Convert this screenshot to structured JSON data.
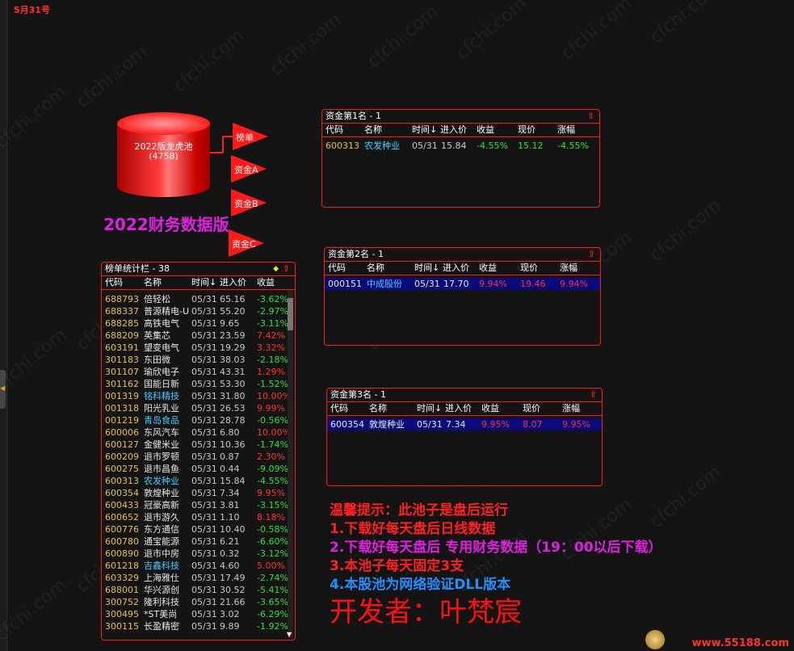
{
  "date_label": "5月31号",
  "watermark": "cfchi.com",
  "pool": {
    "title": "2022版龙虎池",
    "count": "(4758)",
    "flags": [
      "榜单",
      "资金A",
      "资金B",
      "资金C"
    ]
  },
  "big_title": "2022财务数据版",
  "ranking_panel": {
    "title": "榜单统计栏 - 38",
    "headers": [
      "代码",
      "名称",
      "时间↓",
      "进入价",
      "收益"
    ],
    "rows": [
      {
        "code": "688793",
        "name": "倍轻松",
        "time": "05/31",
        "price": "65.16",
        "ret": "-3.62%",
        "name_color": "white",
        "ret_color": "green"
      },
      {
        "code": "688337",
        "name": "普源精电-U",
        "time": "05/31",
        "price": "55.20",
        "ret": "-2.97%",
        "name_color": "white",
        "ret_color": "green"
      },
      {
        "code": "688285",
        "name": "高铁电气",
        "time": "05/31",
        "price": "9.65",
        "ret": "-3.11%",
        "name_color": "white",
        "ret_color": "green"
      },
      {
        "code": "688209",
        "name": "英集芯",
        "time": "05/31",
        "price": "23.59",
        "ret": "7.42%",
        "name_color": "white",
        "ret_color": "red"
      },
      {
        "code": "603191",
        "name": "望变电气",
        "time": "05/31",
        "price": "19.29",
        "ret": "3.32%",
        "name_color": "white",
        "ret_color": "red"
      },
      {
        "code": "301183",
        "name": "东田微",
        "time": "05/31",
        "price": "38.03",
        "ret": "-2.18%",
        "name_color": "white",
        "ret_color": "green"
      },
      {
        "code": "301107",
        "name": "瑜欣电子",
        "time": "05/31",
        "price": "43.31",
        "ret": "1.29%",
        "name_color": "white",
        "ret_color": "red"
      },
      {
        "code": "301162",
        "name": "国能日新",
        "time": "05/31",
        "price": "53.30",
        "ret": "-1.52%",
        "name_color": "white",
        "ret_color": "green"
      },
      {
        "code": "001319",
        "name": "铭科精技",
        "time": "05/31",
        "price": "31.80",
        "ret": "10.00%",
        "name_color": "cyan",
        "ret_color": "red"
      },
      {
        "code": "001318",
        "name": "阳光乳业",
        "time": "05/31",
        "price": "26.53",
        "ret": "9.99%",
        "name_color": "white",
        "ret_color": "red"
      },
      {
        "code": "001219",
        "name": "青岛食品",
        "time": "05/31",
        "price": "28.78",
        "ret": "-0.56%",
        "name_color": "cyan",
        "ret_color": "green"
      },
      {
        "code": "600006",
        "name": "东风汽车",
        "time": "05/31",
        "price": "6.80",
        "ret": "10.00%",
        "name_color": "white",
        "ret_color": "red"
      },
      {
        "code": "600127",
        "name": "金健米业",
        "time": "05/31",
        "price": "10.36",
        "ret": "-1.74%",
        "name_color": "white",
        "ret_color": "green"
      },
      {
        "code": "600209",
        "name": "退市罗顿",
        "time": "05/31",
        "price": "0.87",
        "ret": "2.30%",
        "name_color": "white",
        "ret_color": "red"
      },
      {
        "code": "600275",
        "name": "退市昌鱼",
        "time": "05/31",
        "price": "0.44",
        "ret": "-9.09%",
        "name_color": "white",
        "ret_color": "green"
      },
      {
        "code": "600313",
        "name": "农发种业",
        "time": "05/31",
        "price": "15.84",
        "ret": "-4.55%",
        "name_color": "cyan",
        "ret_color": "green"
      },
      {
        "code": "600354",
        "name": "敦煌种业",
        "time": "05/31",
        "price": "7.34",
        "ret": "9.95%",
        "name_color": "white",
        "ret_color": "red"
      },
      {
        "code": "600433",
        "name": "冠豪高新",
        "time": "05/31",
        "price": "3.81",
        "ret": "-3.15%",
        "name_color": "white",
        "ret_color": "green"
      },
      {
        "code": "600652",
        "name": "退市游久",
        "time": "05/31",
        "price": "1.10",
        "ret": "8.18%",
        "name_color": "white",
        "ret_color": "red"
      },
      {
        "code": "600776",
        "name": "东方通信",
        "time": "05/31",
        "price": "10.40",
        "ret": "-0.58%",
        "name_color": "white",
        "ret_color": "green"
      },
      {
        "code": "600780",
        "name": "通宝能源",
        "time": "05/31",
        "price": "6.21",
        "ret": "-6.60%",
        "name_color": "white",
        "ret_color": "green"
      },
      {
        "code": "600890",
        "name": "退市中房",
        "time": "05/31",
        "price": "0.32",
        "ret": "-3.12%",
        "name_color": "white",
        "ret_color": "green"
      },
      {
        "code": "601218",
        "name": "吉鑫科技",
        "time": "05/31",
        "price": "4.60",
        "ret": "5.00%",
        "name_color": "cyan",
        "ret_color": "red"
      },
      {
        "code": "603329",
        "name": "上海雅仕",
        "time": "05/31",
        "price": "17.49",
        "ret": "-2.74%",
        "name_color": "white",
        "ret_color": "green"
      },
      {
        "code": "688001",
        "name": "华兴源创",
        "time": "05/31",
        "price": "30.52",
        "ret": "-5.41%",
        "name_color": "white",
        "ret_color": "green"
      },
      {
        "code": "300752",
        "name": "隆利科技",
        "time": "05/31",
        "price": "21.66",
        "ret": "-3.65%",
        "name_color": "white",
        "ret_color": "green"
      },
      {
        "code": "300495",
        "name": "*ST美尚",
        "time": "05/31",
        "price": "3.02",
        "ret": "-6.29%",
        "name_color": "white",
        "ret_color": "green"
      },
      {
        "code": "300115",
        "name": "长盈精密",
        "time": "05/31",
        "price": "9.89",
        "ret": "-1.92%",
        "name_color": "white",
        "ret_color": "green"
      }
    ]
  },
  "fund_panels": [
    {
      "title": "资金第1名 - 1",
      "headers": [
        "代码",
        "名称",
        "时间↓",
        "进入价",
        "收益",
        "现价",
        "涨幅"
      ],
      "row": {
        "code": "600313",
        "name": "农发种业",
        "time": "05/31",
        "price": "15.84",
        "ret": "-4.55%",
        "now": "15.12",
        "chg": "-4.55%",
        "color": "green",
        "selected": false
      }
    },
    {
      "title": "资金第2名 - 1",
      "headers": [
        "代码",
        "名称",
        "时间↓",
        "进入价",
        "收益",
        "现价",
        "涨幅"
      ],
      "row": {
        "code": "000151",
        "name": "中成股份",
        "time": "05/31",
        "price": "17.70",
        "ret": "9.94%",
        "now": "19.46",
        "chg": "9.94%",
        "color": "red",
        "selected": true
      }
    },
    {
      "title": "资金第3名 - 1",
      "headers": [
        "代码",
        "名称",
        "时间↓",
        "进入价",
        "收益",
        "现价",
        "涨幅"
      ],
      "row": {
        "code": "600354",
        "name": "敦煌种业",
        "time": "05/31",
        "price": "7.34",
        "ret": "9.95%",
        "now": "8.07",
        "chg": "9.95%",
        "color": "red",
        "selected": true
      }
    }
  ],
  "tips": {
    "t0": "温馨提示：此池子是盘后运行",
    "t1": "1.下载好每天盘后日线数据",
    "t2": "2.下载好每天盘后 专用财务数据（19：00以后下载）",
    "t3": "3.本池子每天固定3支",
    "t4": "4.本股池为网络验证DLL版本",
    "developer": "开发者：叶梵宸"
  },
  "brand": "www.55188.com",
  "colors": {
    "accent_red": "#ff1a1a",
    "magenta": "#e020e0",
    "blue": "#2090ff",
    "selected_row": "#0a0a7a"
  }
}
